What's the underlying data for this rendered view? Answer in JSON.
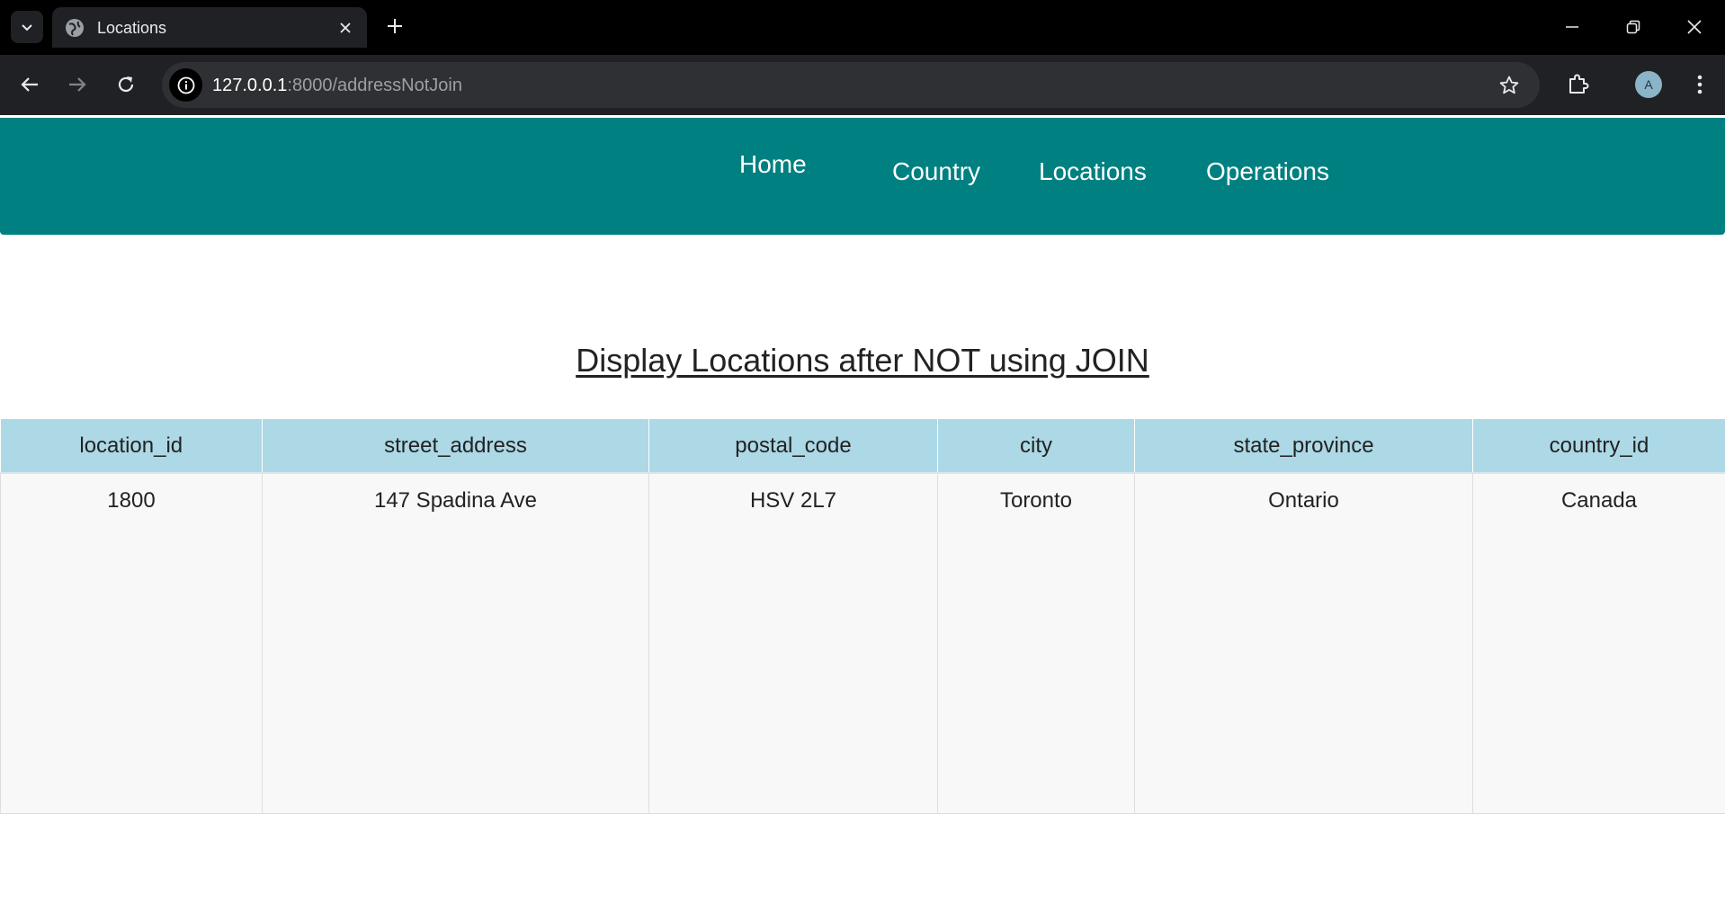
{
  "browser": {
    "tab": {
      "title": "Locations"
    },
    "url": {
      "host": "127.0.0.1",
      "path": ":8000/addressNotJoin"
    },
    "profile_initial": "A"
  },
  "nav": {
    "items": [
      {
        "label": "Home"
      },
      {
        "label": "Country"
      },
      {
        "label": "Locations"
      },
      {
        "label": "Operations"
      }
    ]
  },
  "main": {
    "heading": "Display Locations after NOT using JOIN"
  },
  "table": {
    "columns": [
      "location_id",
      "street_address",
      "postal_code",
      "city",
      "state_province",
      "country_id"
    ],
    "rows": [
      [
        "1800",
        "147 Spadina Ave",
        "HSV 2L7",
        "Toronto",
        "Ontario",
        "Canada"
      ]
    ]
  },
  "colors": {
    "nav_background": "#008080",
    "table_header": "#add8e6",
    "table_cell": "#f8f8f8"
  }
}
